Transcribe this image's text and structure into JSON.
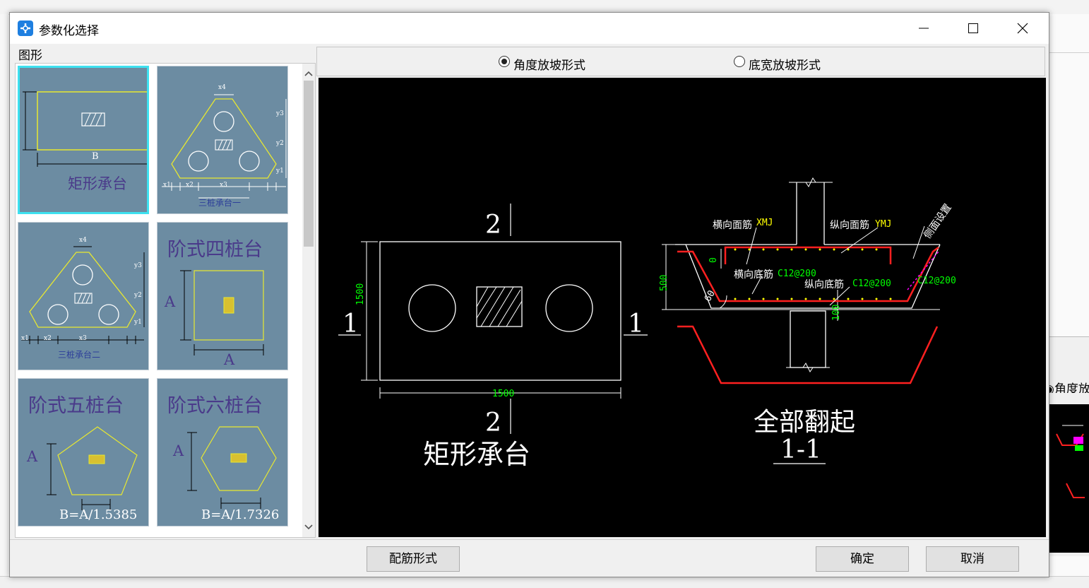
{
  "window": {
    "title": "参数化选择"
  },
  "left_panel": {
    "group_label": "图形",
    "tiles": [
      {
        "label": "矩形承台",
        "dim_label": "B",
        "selected": true
      },
      {
        "label": "三桩承台一",
        "dims": {
          "top": "x4",
          "v1": "y3",
          "v2": "y2",
          "v3": "y1",
          "b1": "x1",
          "b2": "x2",
          "b3": "x3"
        }
      },
      {
        "label": "三桩承台二",
        "dims": {
          "top": "x4",
          "v1": "y3",
          "v2": "y2",
          "v3": "y1",
          "b1": "x1",
          "b2": "x2",
          "b3": "x3"
        }
      },
      {
        "label": "阶式四桩台",
        "dim_a_left": "A",
        "dim_a_bottom": "A"
      },
      {
        "label": "阶式五桩台",
        "dim_a": "A",
        "formula": "B=A/1.5385"
      },
      {
        "label": "阶式六桩台",
        "dim_a": "A",
        "formula": "B=A/1.7326"
      }
    ]
  },
  "options": {
    "radio_angle": {
      "label": "角度放坡形式",
      "checked": true
    },
    "radio_width": {
      "label": "底宽放坡形式",
      "checked": false
    }
  },
  "preview": {
    "plan": {
      "title": "矩形承台",
      "width_dim": "1500",
      "height_dim": "1500",
      "section_mark_h": "1",
      "section_mark_v": "2"
    },
    "section": {
      "title": "全部翻起",
      "label": "1-1",
      "top_transverse": "横向面筋",
      "top_transverse_code": "XMJ",
      "top_longitudinal": "纵向面筋",
      "top_longitudinal_code": "YMJ",
      "bottom_transverse": "横向底筋",
      "bottom_transverse_spec": "C12@200",
      "bottom_longitudinal": "纵向底筋",
      "bottom_longitudinal_spec": "C12@200",
      "side_spec": "C12@200",
      "side_note": "侧面设置",
      "height_dim": "500",
      "cover_dim": "0",
      "bottom_cover": "100",
      "angle": "60"
    }
  },
  "buttons": {
    "rebar_form": "配筋形式",
    "ok": "确定",
    "cancel": "取消"
  },
  "background": {
    "mini_radio_label": "角度放"
  }
}
